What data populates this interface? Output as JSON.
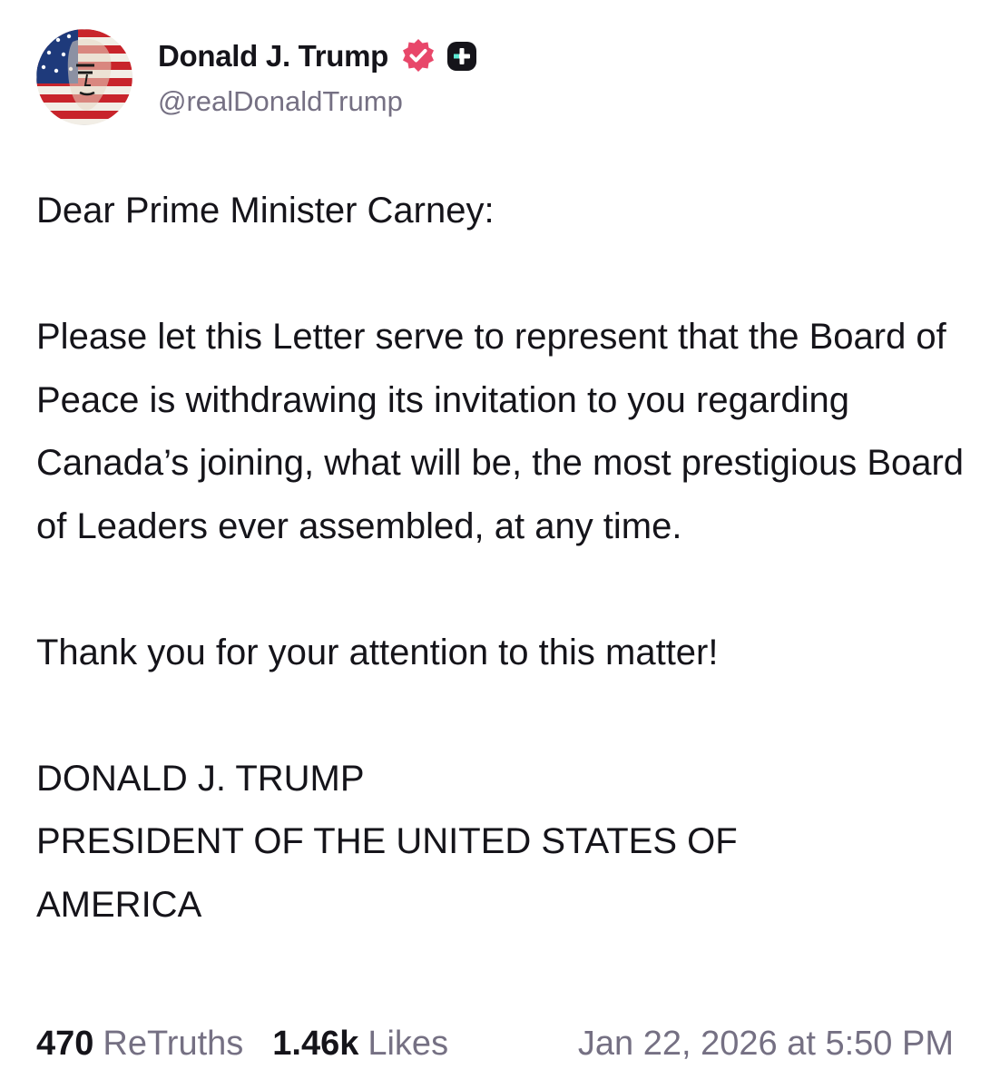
{
  "author": {
    "display_name": "Donald J. Trump",
    "handle": "@realDonaldTrump",
    "verified_badge_icon": "verified-badge-icon",
    "plus_badge_icon": "plus-badge-icon",
    "badge_color": "#e8476a"
  },
  "post": {
    "salutation": "Dear Prime Minister Carney:",
    "paragraph_1": "Please let this Letter serve to represent that the Board of Peace is withdrawing its invitation to you regarding Canada’s joining, what will be, the most prestigious Board of Leaders ever assembled, at any time.",
    "paragraph_2": "Thank you for your attention to this matter!",
    "signature_name": "DONALD J. TRUMP",
    "signature_title": "PRESIDENT OF THE UNITED STATES OF AMERICA"
  },
  "stats": {
    "retruths_count": "470",
    "retruths_label": "ReTruths",
    "likes_count": "1.46k",
    "likes_label": "Likes",
    "timestamp": "Jan 22, 2026 at 5:50 PM"
  }
}
